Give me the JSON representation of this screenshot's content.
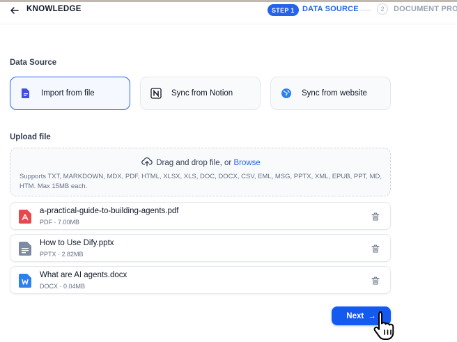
{
  "header": {
    "title": "KNOWLEDGE",
    "steps": [
      {
        "badge": "STEP 1",
        "label": "DATA SOURCE"
      },
      {
        "badge": "2",
        "label": "DOCUMENT PROC"
      }
    ]
  },
  "data_source": {
    "label": "Data Source",
    "options": [
      {
        "label": "Import from file",
        "icon": "file-icon",
        "selected": true
      },
      {
        "label": "Sync from Notion",
        "icon": "notion-icon",
        "selected": false
      },
      {
        "label": "Sync from website",
        "icon": "globe-icon",
        "selected": false
      }
    ]
  },
  "upload": {
    "label": "Upload file",
    "drop_text": "Drag and drop file, or ",
    "browse": "Browse",
    "supported": "Supports TXT, MARKDOWN, MDX, PDF, HTML, XLSX, XLS, DOC, DOCX, CSV, EML, MSG, PPTX, XML, EPUB, PPT, MD, HTM. Max 15MB each."
  },
  "files": [
    {
      "name": "a-practical-guide-to-building-agents.pdf",
      "type": "PDF",
      "size": "7.00MB",
      "color": "#e5484d"
    },
    {
      "name": "How to Use Dify.pptx",
      "type": "PPTX",
      "size": "2.82MB",
      "color": "#7d8aa3"
    },
    {
      "name": "What are AI agents.docx",
      "type": "DOCX",
      "size": "0.04MB",
      "color": "#2f80ed"
    }
  ],
  "footer": {
    "next_label": "Next",
    "next_arrow": "→"
  },
  "colors": {
    "accent": "#155aef",
    "step": "#2563eb"
  }
}
